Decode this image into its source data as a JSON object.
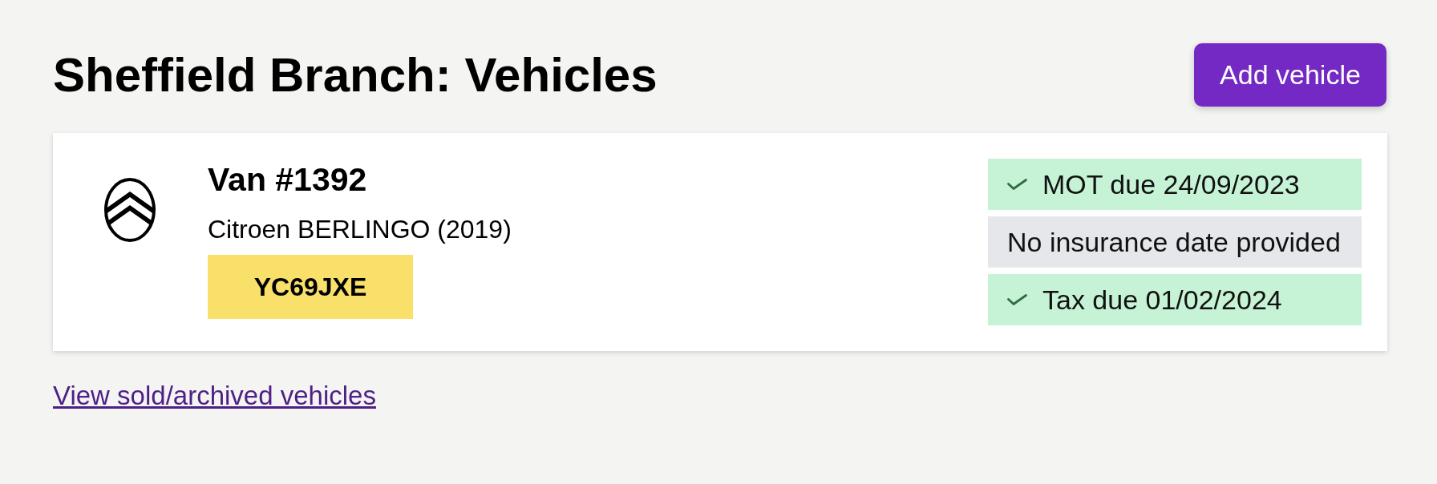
{
  "page": {
    "title": "Sheffield Branch: Vehicles"
  },
  "add_button": {
    "label": "Add vehicle"
  },
  "vehicles": [
    {
      "name": "Van #1392",
      "model": "Citroen BERLINGO (2019)",
      "registration": "YC69JXE",
      "statuses": [
        {
          "kind": "ok",
          "text": "MOT due 24/09/2023"
        },
        {
          "kind": "missing",
          "text": "No insurance date provided"
        },
        {
          "kind": "ok",
          "text": "Tax due 01/02/2024"
        }
      ]
    }
  ],
  "footer_link": {
    "label": "View sold/archived vehicles"
  }
}
